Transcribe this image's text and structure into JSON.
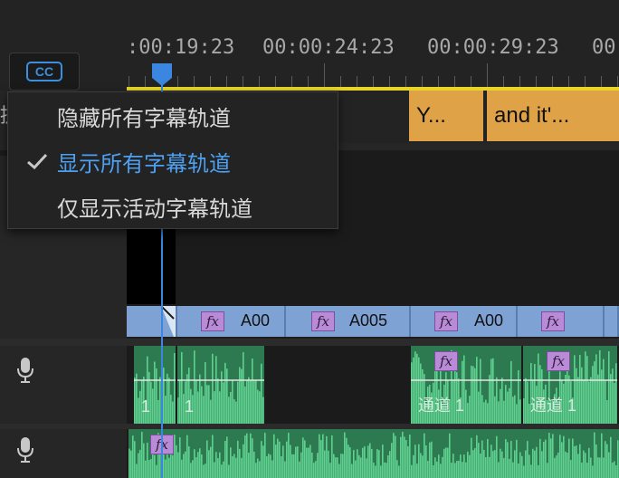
{
  "ruler": {
    "timecodes": [
      ":00:19:23",
      "00:00:24:23",
      "00:00:29:23",
      "00"
    ]
  },
  "cc_button": {
    "label": "CC"
  },
  "side_char": "提",
  "caption_clips": [
    {
      "text": "Y..."
    },
    {
      "text": "and it'..."
    }
  ],
  "context_menu": {
    "items": [
      {
        "label": "隐藏所有字幕轨道",
        "checked": false
      },
      {
        "label": "显示所有字幕轨道",
        "checked": true
      },
      {
        "label": "仅显示活动字幕轨道",
        "checked": false
      }
    ]
  },
  "video_clips": [
    {
      "label": "A00",
      "fx": "fx"
    },
    {
      "label": "A005",
      "fx": "fx"
    },
    {
      "label": "A00",
      "fx": "fx"
    },
    {
      "label": "",
      "fx": "fx"
    }
  ],
  "audio_clips_a1": [
    {
      "label": "1"
    },
    {
      "label": "1"
    },
    {
      "label": "通道 1",
      "fx": "fx"
    },
    {
      "label": "通道 1",
      "fx": "fx"
    }
  ],
  "audio_a2": {
    "fx": "fx"
  },
  "colors": {
    "accent_blue": "#3b8fe0",
    "caption_orange": "#e0a247",
    "video_blue": "#7fa2d4",
    "audio_green": "#2d7a50",
    "waveform_green": "#5fd08f",
    "fx_purple": "#b98bd6",
    "work_area_yellow": "#e8d52a"
  },
  "icons": {
    "cc": "cc-icon",
    "check": "checkmark-icon",
    "mic": "microphone-icon",
    "playhead": "playhead-icon",
    "fx": "fx-badge-icon"
  }
}
